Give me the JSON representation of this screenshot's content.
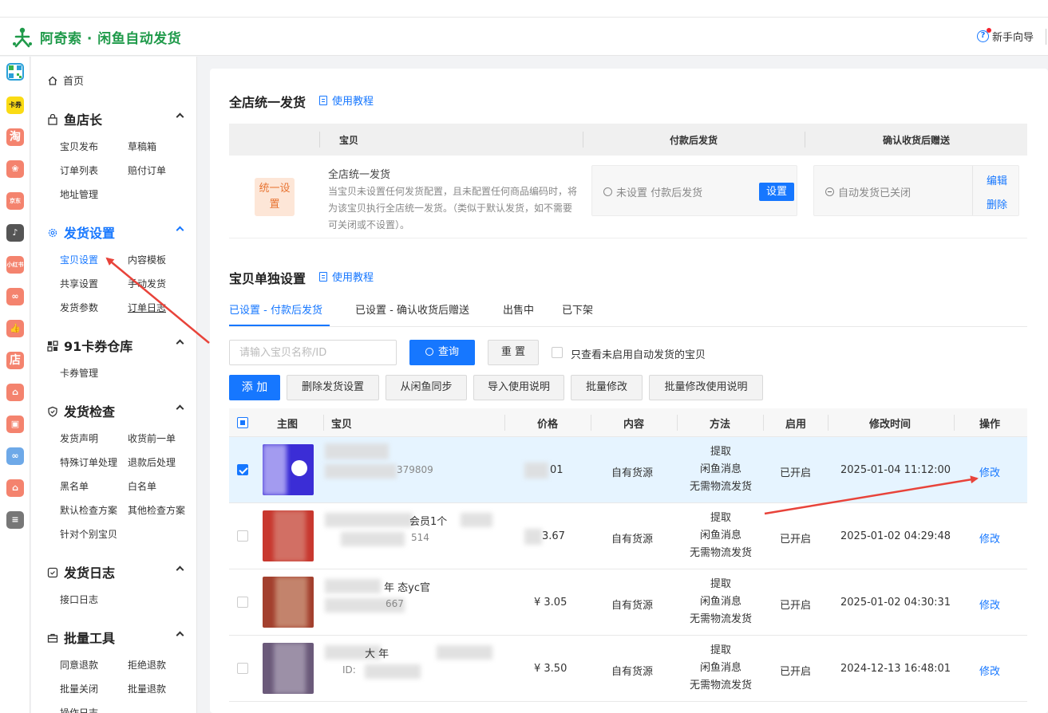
{
  "app": {
    "title": "阿奇索 · 闲鱼自动发货",
    "guide": "新手向导"
  },
  "rail": [
    {
      "icon": "qrcode-icon",
      "label": ""
    },
    {
      "icon": "kashui-icon",
      "label": "卡券"
    },
    {
      "icon": "taobao-icon",
      "label": "淘"
    },
    {
      "icon": "tmall-icon",
      "label": ""
    },
    {
      "icon": "jd-icon",
      "label": "京东"
    },
    {
      "icon": "douyin-icon",
      "label": "♪"
    },
    {
      "icon": "xiaohongshu-icon",
      "label": "小红书"
    },
    {
      "icon": "kuaishou-icon",
      "label": ""
    },
    {
      "icon": "thumb-icon",
      "label": ""
    },
    {
      "icon": "dian-icon",
      "label": "店"
    },
    {
      "icon": "bag-icon",
      "label": ""
    },
    {
      "icon": "bag2-icon",
      "label": ""
    },
    {
      "icon": "link-icon",
      "label": ""
    },
    {
      "icon": "shop-icon",
      "label": ""
    },
    {
      "icon": "weidian-icon",
      "label": ""
    }
  ],
  "sidebar": {
    "home": "首页",
    "groups": [
      {
        "title": "鱼店长",
        "items": [
          "宝贝发布",
          "草稿箱",
          "订单列表",
          "赔付订单",
          "地址管理"
        ]
      },
      {
        "title": "发货设置",
        "items": [
          "宝贝设置",
          "内容模板",
          "共享设置",
          "手动发货",
          "发货参数",
          "订单日志"
        ]
      },
      {
        "title": "91卡券仓库",
        "items": [
          "卡券管理"
        ]
      },
      {
        "title": "发货检查",
        "items": [
          "发货声明",
          "收货前一单",
          "特殊订单处理",
          "退款后处理",
          "黑名单",
          "白名单",
          "默认检查方案",
          "其他检查方案",
          "针对个别宝贝"
        ]
      },
      {
        "title": "发货日志",
        "items": [
          "接口日志"
        ]
      },
      {
        "title": "批量工具",
        "items": [
          "同意退款",
          "拒绝退款",
          "批量关闭",
          "批量退款",
          "操作日志"
        ]
      }
    ]
  },
  "store_section": {
    "title": "全店统一发货",
    "tutorial": "使用教程",
    "headers": [
      "宝贝",
      "付款后发货",
      "确认收货后赠送"
    ],
    "badge": "统一设置",
    "name": "全店统一发货",
    "desc": "当宝贝未设置任何发货配置，且未配置任何商品编码时，将为该宝贝执行全店统一发货。（类似于默认发货，如不需要可关闭或不设置）。",
    "pay_status": "未设置 付款后发货",
    "set_button": "设置",
    "gift_status": "自动发货已关闭",
    "edit": "编辑",
    "delete": "删除"
  },
  "item_section": {
    "title": "宝贝单独设置",
    "tutorial": "使用教程",
    "tabs": [
      "已设置 - 付款后发货",
      "已设置 - 确认收货后赠送",
      "出售中",
      "已下架"
    ],
    "search_placeholder": "请输入宝贝名称/ID",
    "query": "查询",
    "reset": "重 置",
    "only_unenabled": "只查看未启用自动发货的宝贝",
    "actions": [
      "添 加",
      "删除发货设置",
      "从闲鱼同步",
      "导入使用说明",
      "批量修改",
      "批量修改使用说明"
    ],
    "columns": [
      "主图",
      "宝贝",
      "价格",
      "内容",
      "方法",
      "启用",
      "修改时间",
      "操作"
    ],
    "rows": [
      {
        "selected": true,
        "title": "",
        "id": "379809",
        "price": "01",
        "content": "自有货源",
        "method": [
          "提取",
          "闲鱼消息",
          "无需物流发货"
        ],
        "enabled": "已开启",
        "time": "2025-01-04 11:12:00",
        "action": "修改"
      },
      {
        "selected": false,
        "title": "会员1个",
        "id": "514",
        "price": "3.67",
        "content": "自有货源",
        "method": [
          "提取",
          "闲鱼消息",
          "无需物流发货"
        ],
        "enabled": "已开启",
        "time": "2025-01-02 04:29:48",
        "action": "修改"
      },
      {
        "selected": false,
        "title": "年 态yc官",
        "id": "667",
        "price": "¥ 3.05",
        "content": "自有货源",
        "method": [
          "提取",
          "闲鱼消息",
          "无需物流发货"
        ],
        "enabled": "已开启",
        "time": "2025-01-02 04:30:31",
        "action": "修改"
      },
      {
        "selected": false,
        "title": "大 年",
        "id": "ID:",
        "price": "¥ 3.50",
        "content": "自有货源",
        "method": [
          "提取",
          "闲鱼消息",
          "无需物流发货"
        ],
        "enabled": "已开启",
        "time": "2024-12-13 16:48:01",
        "action": "修改"
      }
    ]
  },
  "colors": {
    "accent": "#1677ff",
    "brand": "#1f9a4a",
    "arrow": "#e8433a"
  }
}
